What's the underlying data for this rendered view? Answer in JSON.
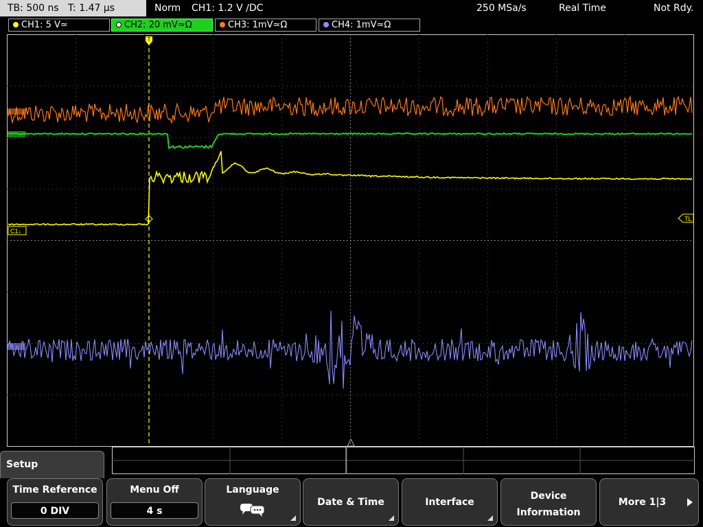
{
  "status_bar": {
    "timebase": "TB: 500 ns",
    "trigger_time": "T: 1.47 µs",
    "mode": "Norm",
    "trigger_info": "CH1: 1.2 V ∕DC",
    "sample_rate": "250 MSa/s",
    "acq_mode": "Real Time",
    "trigger_state": "Not Rdy."
  },
  "channels": [
    {
      "label": "CH1: 5 V≃",
      "color": "#ffff00",
      "active": false
    },
    {
      "label": "CH2: 20 mV≃Ω",
      "color": "#1ed01e",
      "active": true
    },
    {
      "label": "CH3: 1mV≃Ω",
      "color": "#ff7a1a",
      "active": false
    },
    {
      "label": "CH4: 1mV≃Ω",
      "color": "#8c8cff",
      "active": false
    }
  ],
  "screen": {
    "ch1_marker": "C1↓",
    "trigger_level_marker": "TL",
    "trigger_position": "T"
  },
  "menu": {
    "title": "Setup",
    "softkeys": {
      "time_reference": {
        "label": "Time Reference",
        "value": "0 DIV"
      },
      "menu_off": {
        "label": "Menu Off",
        "value": "4 s"
      },
      "language": {
        "label": "Language",
        "icon": "speech-bubbles-icon"
      },
      "date_time": {
        "label": "Date & Time"
      },
      "interface": {
        "label": "Interface"
      },
      "device_info": {
        "line1": "Device",
        "line2": "Information"
      },
      "more": {
        "label": "More 1|3"
      }
    }
  }
}
